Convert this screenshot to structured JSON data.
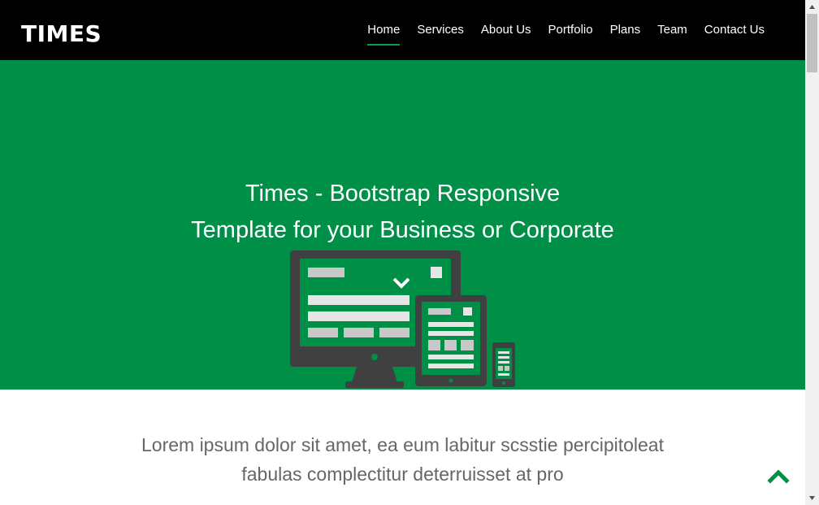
{
  "brand": "TIMES",
  "nav": {
    "items": [
      {
        "label": "Home",
        "active": true
      },
      {
        "label": "Services"
      },
      {
        "label": "About Us"
      },
      {
        "label": "Portfolio"
      },
      {
        "label": "Plans"
      },
      {
        "label": "Team"
      },
      {
        "label": "Contact Us"
      }
    ]
  },
  "hero": {
    "title_line1": "Times - Bootstrap Responsive",
    "title_line2": "Template for your Business or Corporate",
    "background": "#008f47",
    "illustration_icon": "responsive-devices-icon"
  },
  "about": {
    "lead_line1": "Lorem ipsum dolor sit amet, ea eum labitur scsstie percipitoleat",
    "lead_line2": "fabulas complectitur deterruisset at pro"
  },
  "back_to_top_icon": "chevron-up-icon",
  "colors": {
    "navbar": "#000000",
    "accent": "#008f47",
    "text_muted": "#666666"
  }
}
